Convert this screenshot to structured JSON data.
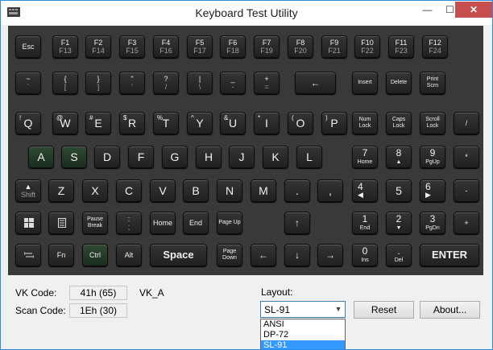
{
  "window": {
    "title": "Keyboard Test Utility",
    "buttons": {
      "minimize": "—",
      "maximize": "☐",
      "close": "✕"
    }
  },
  "keyboard": {
    "f_row": [
      {
        "label": "Esc"
      },
      {
        "top": "F1",
        "bottom": "F13"
      },
      {
        "top": "F2",
        "bottom": "F14"
      },
      {
        "top": "F3",
        "bottom": "F15"
      },
      {
        "top": "F4",
        "bottom": "F16"
      },
      {
        "top": "F5",
        "bottom": "F17"
      },
      {
        "top": "F6",
        "bottom": "F18"
      },
      {
        "top": "F7",
        "bottom": "F19"
      },
      {
        "top": "F8",
        "bottom": "F20"
      },
      {
        "top": "F9",
        "bottom": "F21"
      },
      {
        "top": "F10",
        "bottom": "F22"
      },
      {
        "top": "F11",
        "bottom": "F23"
      },
      {
        "top": "F12",
        "bottom": "F24"
      }
    ],
    "num_row": [
      {
        "top": "~",
        "bottom": "`"
      },
      {
        "top": "{",
        "bottom": "["
      },
      {
        "top": "}",
        "bottom": "]"
      },
      {
        "top": "\"",
        "bottom": "'"
      },
      {
        "top": "?",
        "bottom": "/"
      },
      {
        "top": "|",
        "bottom": "\\"
      },
      {
        "top": "_",
        "bottom": "-"
      },
      {
        "top": "+",
        "bottom": "="
      },
      {
        "label": "←"
      },
      {
        "label": "Insert"
      },
      {
        "label": "Delete"
      },
      {
        "label": "Print Scrn"
      }
    ],
    "q_row": [
      {
        "small": "!",
        "main": "Q"
      },
      {
        "small": "@",
        "main": "W"
      },
      {
        "small": "#",
        "main": "E"
      },
      {
        "small": "$",
        "main": "R"
      },
      {
        "small": "%",
        "main": "T"
      },
      {
        "small": "^",
        "main": "Y"
      },
      {
        "small": "&",
        "main": "U"
      },
      {
        "small": "*",
        "main": "I"
      },
      {
        "small": "(",
        "main": "O"
      },
      {
        "small": ")",
        "main": "P"
      },
      {
        "label": "Num Lock"
      },
      {
        "label": "Caps Lock"
      },
      {
        "label": "Scroll Lock"
      },
      {
        "label": "/"
      }
    ],
    "a_row": [
      {
        "label": "A"
      },
      {
        "label": "S"
      },
      {
        "label": "D"
      },
      {
        "label": "F"
      },
      {
        "label": "G"
      },
      {
        "label": "H"
      },
      {
        "label": "J"
      },
      {
        "label": "K"
      },
      {
        "label": "L"
      },
      {
        "top": "7",
        "bottom": "Home"
      },
      {
        "top": "8",
        "bottom": "▲"
      },
      {
        "top": "9",
        "bottom": "PgUp"
      },
      {
        "label": "*"
      }
    ],
    "z_row": [
      {
        "top": "▲",
        "bottom": "Shift"
      },
      {
        "label": "Z"
      },
      {
        "label": "X"
      },
      {
        "label": "C"
      },
      {
        "label": "V"
      },
      {
        "label": "B"
      },
      {
        "label": "N"
      },
      {
        "label": "M"
      },
      {
        "label": "."
      },
      {
        "label": ","
      },
      {
        "left": "4",
        "right": "◀"
      },
      {
        "label": "5"
      },
      {
        "left": "6",
        "right": "▶"
      },
      {
        "label": "-"
      }
    ],
    "win_row": [
      {
        "label": "win"
      },
      {
        "label": "menu"
      },
      {
        "label": "Pause Break"
      },
      {
        "top": ":",
        "bottom": ";"
      },
      {
        "label": "Home"
      },
      {
        "label": "End"
      },
      {
        "label": "Page Up"
      },
      {
        "label": "↑"
      },
      {
        "top": "1",
        "bottom": "End"
      },
      {
        "top": "2",
        "bottom": "▼"
      },
      {
        "top": "3",
        "bottom": "PgDn"
      },
      {
        "label": "+"
      }
    ],
    "bottom_row": [
      {
        "label": "tab"
      },
      {
        "label": "Fn"
      },
      {
        "label": "Ctrl"
      },
      {
        "label": "Alt"
      },
      {
        "label": "Space"
      },
      {
        "label": "Page Down"
      },
      {
        "label": "←"
      },
      {
        "label": "↓"
      },
      {
        "label": "→"
      },
      {
        "top": "0",
        "bottom": "Ins"
      },
      {
        "top": ".",
        "bottom": "Del"
      },
      {
        "label": "ENTER"
      }
    ]
  },
  "status": {
    "vk_label": "VK Code:",
    "vk_value": "41h (65)",
    "vk_name": "VK_A",
    "scan_label": "Scan Code:",
    "scan_value": "1Eh (30)"
  },
  "layout": {
    "label": "Layout:",
    "selected": "SL-91",
    "options": [
      "ANSI",
      "DP-72",
      "SL-91"
    ]
  },
  "buttons": {
    "reset": "Reset",
    "about": "About..."
  },
  "colors": {
    "keyboard_bg": "#393939",
    "key_bg": "#2a2a2a",
    "key_pressed": "#223826",
    "selection": "#3399ff",
    "close_button": "#c74f50"
  }
}
